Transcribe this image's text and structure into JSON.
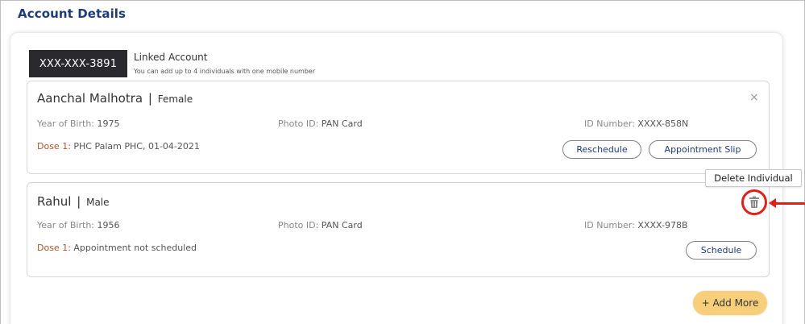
{
  "page": {
    "title": "Account Details"
  },
  "account": {
    "masked_number": "XXX-XXX-3891",
    "linked_label": "Linked Account",
    "linked_subtitle": "You can add up to 4 individuals with one mobile number"
  },
  "labels": {
    "separator": "|",
    "year_of_birth": "Year of Birth:",
    "photo_id": "Photo ID:",
    "id_number": "ID Number:",
    "dose": "Dose 1:"
  },
  "individuals": [
    {
      "name": "Aanchal Malhotra",
      "gender": "Female",
      "year_of_birth": "1975",
      "photo_id": "PAN Card",
      "id_number": "XXXX-858N",
      "dose_text": "PHC Palam PHC, 01-04-2021",
      "actions": [
        "Reschedule",
        "Appointment Slip"
      ],
      "close_icon": "×"
    },
    {
      "name": "Rahul",
      "gender": "Male",
      "year_of_birth": "1956",
      "photo_id": "PAN Card",
      "id_number": "XXXX-978B",
      "dose_text": "Appointment not scheduled",
      "actions": [
        "Schedule"
      ]
    }
  ],
  "tooltip": {
    "text": "Delete Individual"
  },
  "add_more": {
    "label": "+ Add More"
  },
  "colors": {
    "title": "#1d3b7a",
    "badge_bg": "#2a2a2e",
    "dose_label": "#b3542b",
    "add_more_bg": "#f7cf7a",
    "highlight": "#e0201b"
  },
  "icons": {
    "delete": "trash-icon",
    "close": "close-icon",
    "pointer": "arrow-left-icon"
  }
}
